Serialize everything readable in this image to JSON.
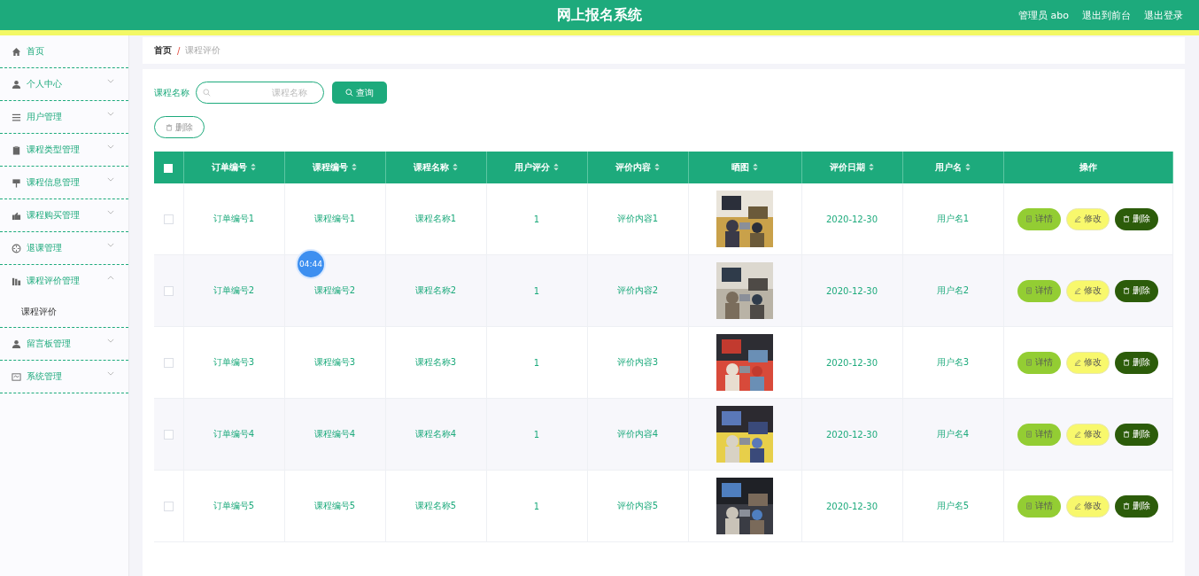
{
  "header": {
    "title": "网上报名系统",
    "user": "管理员 abo",
    "links": [
      "退出到前台",
      "退出登录"
    ]
  },
  "sidebar": {
    "items": [
      {
        "label": "首页",
        "kind": "link"
      },
      {
        "label": "个人中心",
        "kind": "menu",
        "expanded": false
      },
      {
        "label": "用户管理",
        "kind": "menu",
        "expanded": false
      },
      {
        "label": "课程类型管理",
        "kind": "menu",
        "expanded": false
      },
      {
        "label": "课程信息管理",
        "kind": "menu",
        "expanded": false
      },
      {
        "label": "课程购买管理",
        "kind": "menu",
        "expanded": false
      },
      {
        "label": "退课管理",
        "kind": "menu",
        "expanded": false
      },
      {
        "label": "课程评价管理",
        "kind": "menu",
        "expanded": true,
        "children": [
          {
            "label": "课程评价",
            "selected": true
          }
        ]
      },
      {
        "label": "留言板管理",
        "kind": "menu",
        "expanded": false
      },
      {
        "label": "系统管理",
        "kind": "menu",
        "expanded": false
      }
    ]
  },
  "breadcrumb": [
    "首页",
    "/",
    "课程评价"
  ],
  "search": {
    "label": "课程名称",
    "placeholder": "课程名称",
    "button": "查询"
  },
  "delete_button": "删除",
  "table": {
    "header_checkbox": {
      "checked": false
    },
    "columns": [
      {
        "label": "订单编号",
        "sortable": true
      },
      {
        "label": "课程编号",
        "sortable": true
      },
      {
        "label": "课程名称",
        "sortable": true
      },
      {
        "label": "用户评分",
        "sortable": true
      },
      {
        "label": "评价内容",
        "sortable": true
      },
      {
        "label": "晒图",
        "sortable": true
      },
      {
        "label": "评价日期",
        "sortable": true
      },
      {
        "label": "用户名",
        "sortable": true
      },
      {
        "label": "操作",
        "sortable": false
      }
    ],
    "rows": [
      {
        "checked": false,
        "order_no": "订单编号1",
        "course_no": "课程编号1",
        "course_name": "课程名称1",
        "rating": "1",
        "content": "评价内容1",
        "date": "2020-12-30",
        "user": "用户名1",
        "actions": [
          "详情",
          "修改",
          "删除"
        ]
      },
      {
        "checked": false,
        "order_no": "订单编号2",
        "course_no": "课程编号2",
        "course_name": "课程名称2",
        "rating": "1",
        "content": "评价内容2",
        "date": "2020-12-30",
        "user": "用户名2",
        "actions": [
          "详情",
          "修改",
          "删除"
        ]
      },
      {
        "checked": false,
        "order_no": "订单编号3",
        "course_no": "课程编号3",
        "course_name": "课程名称3",
        "rating": "1",
        "content": "评价内容3",
        "date": "2020-12-30",
        "user": "用户名3",
        "actions": [
          "详情",
          "修改",
          "删除"
        ]
      },
      {
        "checked": false,
        "order_no": "订单编号4",
        "course_no": "课程编号4",
        "course_name": "课程名称4",
        "rating": "1",
        "content": "评价内容4",
        "date": "2020-12-30",
        "user": "用户名4",
        "actions": [
          "详情",
          "修改",
          "删除"
        ]
      },
      {
        "checked": false,
        "order_no": "订单编号5",
        "course_no": "课程编号5",
        "course_name": "课程名称5",
        "rating": "1",
        "content": "评价内容5",
        "date": "2020-12-30",
        "user": "用户名5",
        "actions": [
          "详情",
          "修改",
          "删除"
        ]
      }
    ]
  },
  "timer_badge": "04:44"
}
